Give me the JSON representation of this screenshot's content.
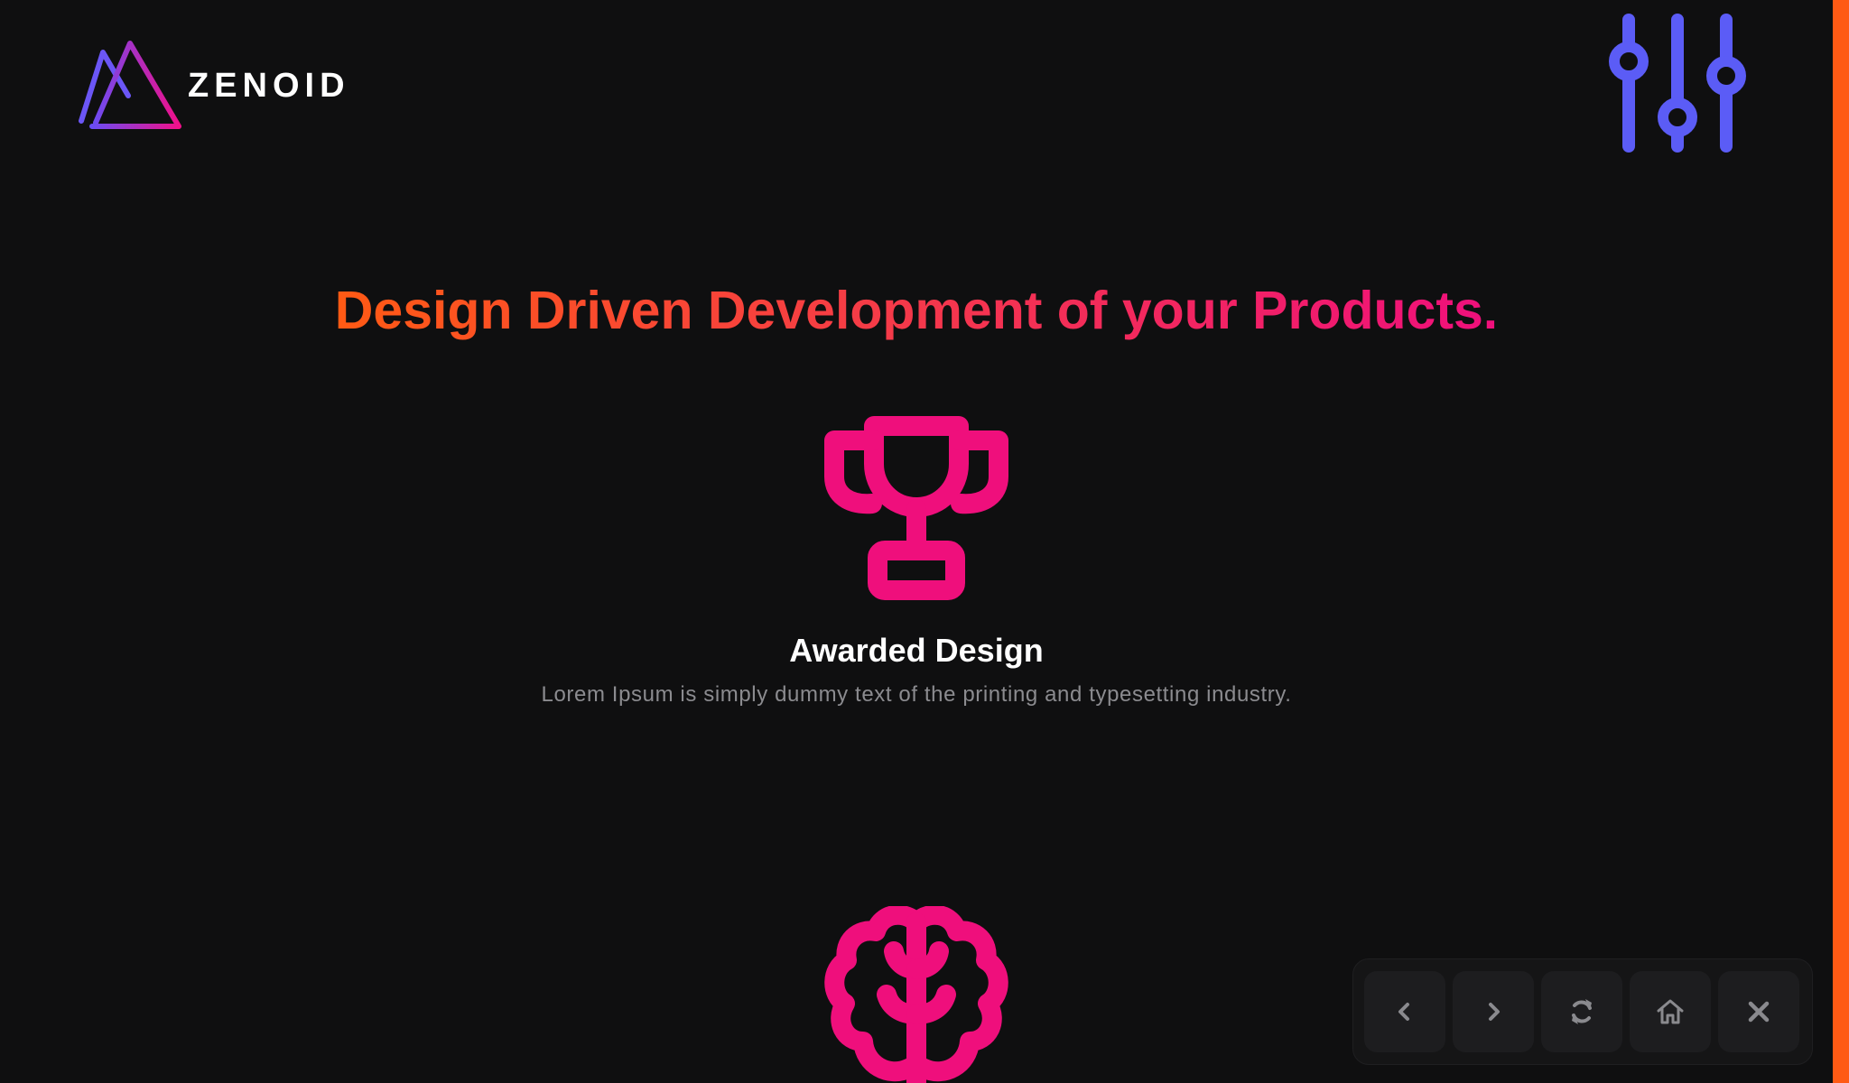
{
  "header": {
    "brand": "ZENOID",
    "settings_icon": "sliders-icon"
  },
  "hero": {
    "headline": "Design Driven Development of your Products."
  },
  "features": [
    {
      "icon": "trophy-icon",
      "title": "Awarded Design",
      "description": "Lorem Ipsum is simply dummy text of the printing and typesetting industry."
    },
    {
      "icon": "brain-icon"
    }
  ],
  "nav_panel": {
    "buttons": [
      {
        "icon": "chevron-left-icon"
      },
      {
        "icon": "chevron-right-icon"
      },
      {
        "icon": "refresh-icon"
      },
      {
        "icon": "home-icon"
      },
      {
        "icon": "close-icon"
      }
    ]
  },
  "colors": {
    "background": "#0f0f10",
    "accent_orange": "#ff5a14",
    "accent_pink": "#ef0f7c",
    "accent_purple": "#5b5cf6",
    "text_muted": "#8b8b8f"
  }
}
